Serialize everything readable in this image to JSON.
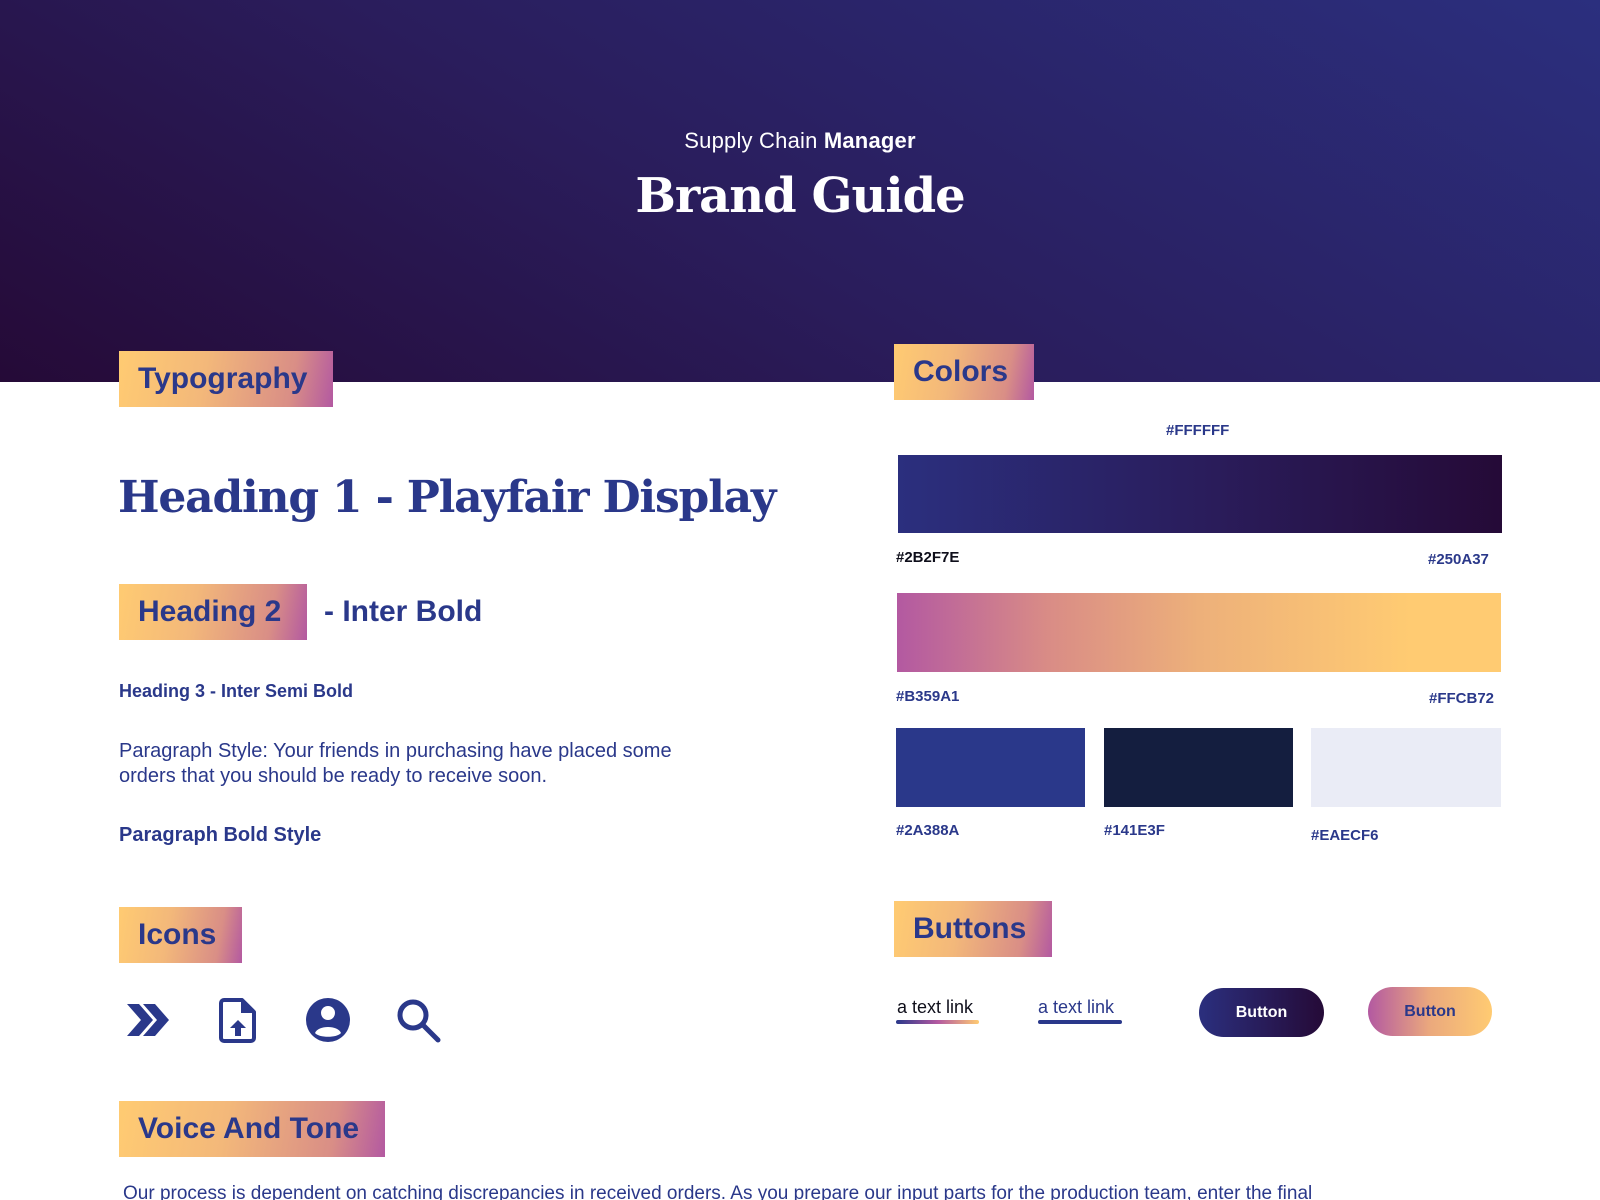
{
  "hero": {
    "subtitle_light": "Supply Chain",
    "subtitle_bold": "Manager",
    "title": "Brand Guide"
  },
  "typography": {
    "section_title": "Typography",
    "h1_sample": "Heading 1 - Playfair Display",
    "h2_sample": "Heading 2",
    "h2_suffix": "- Inter Bold",
    "h3_sample": "Heading 3 - Inter Semi Bold",
    "paragraph_sample": "Paragraph Style: Your friends in purchasing have placed some orders that you should be ready to receive soon.",
    "paragraph_bold_sample": "Paragraph Bold Style"
  },
  "icons": {
    "section_title": "Icons",
    "items": [
      {
        "name": "double-chevron-right-icon"
      },
      {
        "name": "file-upload-icon"
      },
      {
        "name": "user-circle-icon"
      },
      {
        "name": "search-icon"
      }
    ]
  },
  "colors": {
    "section_title": "Colors",
    "white_label": "#FFFFFF",
    "gradient_dark": {
      "start": "#2B2F7E",
      "end": "#250A37"
    },
    "gradient_warm": {
      "start": "#B359A1",
      "end": "#FFCB72"
    },
    "solids": [
      {
        "hex": "#2A388A"
      },
      {
        "hex": "#141E3F"
      },
      {
        "hex": "#EAECF6"
      }
    ]
  },
  "buttons": {
    "section_title": "Buttons",
    "link_gradient_label": "a text link",
    "link_solid_label": "a text link",
    "button_dark_label": "Button",
    "button_warm_label": "Button"
  },
  "voice": {
    "section_title": "Voice And Tone",
    "body": "Our process is dependent on catching discrepancies in received orders. As you prepare our input parts for the production team, enter the final"
  }
}
